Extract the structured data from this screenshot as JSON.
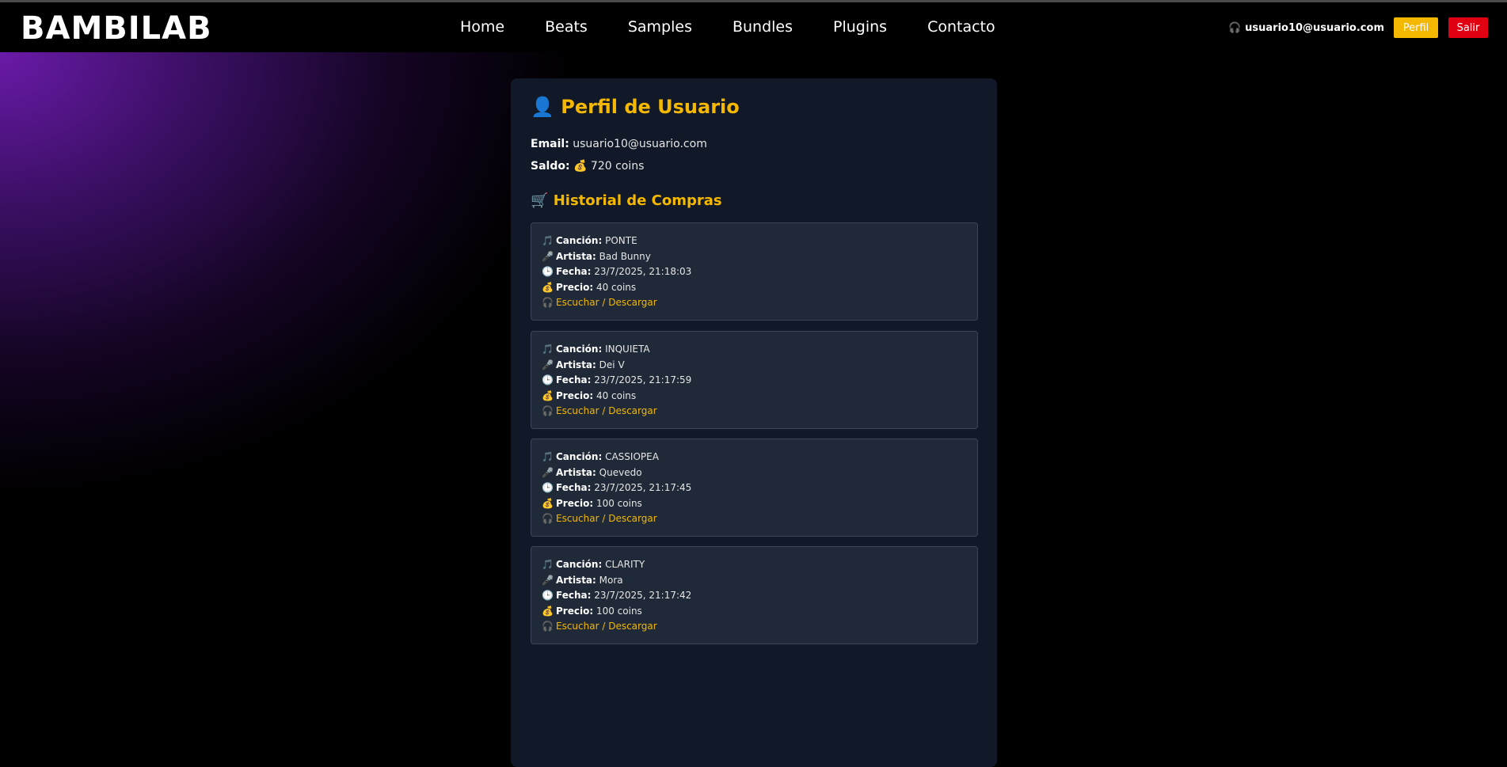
{
  "header": {
    "logo": "BAMBILAB",
    "nav": [
      "Home",
      "Beats",
      "Samples",
      "Bundles",
      "Plugins",
      "Contacto"
    ],
    "user_icon": "🎧",
    "user_email": "usuario10@usuario.com",
    "perfil_label": "Perfil",
    "salir_label": "Salir"
  },
  "profile": {
    "title_icon": "👤",
    "title": "Perfil de Usuario",
    "email_label": "Email:",
    "email": "usuario10@usuario.com",
    "saldo_label": "Saldo:",
    "saldo_icon": "💰",
    "saldo": "720 coins"
  },
  "history": {
    "icon": "🛒",
    "title": "Historial de Compras",
    "labels": {
      "song": "Canción:",
      "artist": "Artista:",
      "date": "Fecha:",
      "price": "Precio:",
      "link": "Escuchar / Descargar"
    },
    "icons": {
      "song": "🎵",
      "artist": "🎤",
      "date": "🕒",
      "price": "💰",
      "link": "🎧"
    },
    "purchases": [
      {
        "song": "PONTE",
        "artist": "Bad Bunny",
        "date": "23/7/2025, 21:18:03",
        "price": "40 coins"
      },
      {
        "song": "INQUIETA",
        "artist": "Dei V",
        "date": "23/7/2025, 21:17:59",
        "price": "40 coins"
      },
      {
        "song": "CASSIOPEA",
        "artist": "Quevedo",
        "date": "23/7/2025, 21:17:45",
        "price": "100 coins"
      },
      {
        "song": "CLARITY",
        "artist": "Mora",
        "date": "23/7/2025, 21:17:42",
        "price": "100 coins"
      }
    ]
  }
}
